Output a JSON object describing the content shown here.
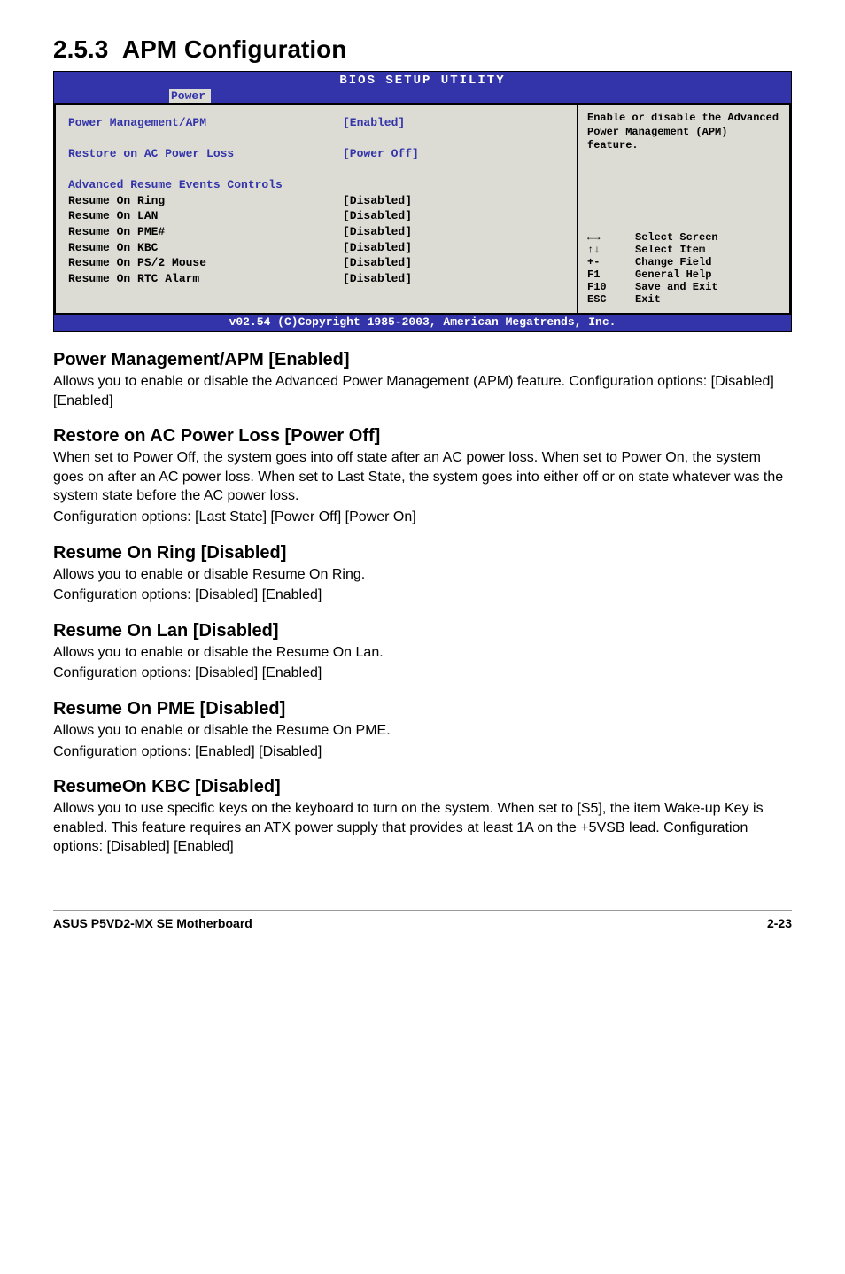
{
  "section": {
    "number": "2.5.3",
    "title": "APM Configuration"
  },
  "bios": {
    "title": "BIOS SETUP UTILITY",
    "tab": "Power",
    "left": {
      "rows": [
        {
          "label": "Power Management/APM",
          "value": "[Enabled]",
          "style": "blue"
        },
        {
          "label": "",
          "value": ""
        },
        {
          "label": "Restore on AC Power Loss",
          "value": "[Power Off]",
          "style": "blue"
        },
        {
          "label": "",
          "value": ""
        },
        {
          "label": "Advanced Resume Events Controls",
          "value": "",
          "style": "blue-label-only"
        },
        {
          "label": "Resume On Ring",
          "value": "[Disabled]",
          "style": "black"
        },
        {
          "label": "Resume On LAN",
          "value": "[Disabled]",
          "style": "black"
        },
        {
          "label": "Resume On PME#",
          "value": "[Disabled]",
          "style": "black"
        },
        {
          "label": "Resume On KBC",
          "value": "[Disabled]",
          "style": "black"
        },
        {
          "label": "Resume On PS/2 Mouse",
          "value": "[Disabled]",
          "style": "black"
        },
        {
          "label": "Resume On RTC Alarm",
          "value": "[Disabled]",
          "style": "black"
        }
      ]
    },
    "right": {
      "help": "Enable or disable the Advanced Power Management (APM) feature.",
      "keys": [
        {
          "k": "←→",
          "d": "Select Screen"
        },
        {
          "k": "↑↓",
          "d": "Select Item"
        },
        {
          "k": "+-",
          "d": "Change Field"
        },
        {
          "k": "F1",
          "d": "General Help"
        },
        {
          "k": "F10",
          "d": "Save and Exit"
        },
        {
          "k": "ESC",
          "d": "Exit"
        }
      ]
    },
    "footer": "v02.54 (C)Copyright 1985-2003, American Megatrends, Inc."
  },
  "sections": [
    {
      "h": "Power Management/APM [Enabled]",
      "p": "Allows you to enable or disable the Advanced Power Management (APM) feature. Configuration options: [Disabled] [Enabled]"
    },
    {
      "h": "Restore on AC Power Loss [Power Off]",
      "p": "When set to Power Off, the system goes into off state after an AC power loss. When set to Power On, the system goes on after an AC power loss. When set to Last State, the system goes into either off or on state whatever was the system state before the AC power loss.\nConfiguration options: [Last State] [Power Off] [Power On]"
    },
    {
      "h": "Resume On Ring [Disabled]",
      "p": "Allows you to enable or disable Resume On Ring.\nConfiguration options: [Disabled] [Enabled]"
    },
    {
      "h": "Resume On Lan [Disabled]",
      "p": "Allows you to enable or disable the Resume On Lan.\nConfiguration options: [Disabled] [Enabled]"
    },
    {
      "h": "Resume On PME [Disabled]",
      "p": "Allows you to enable or disable the Resume On PME.\nConfiguration options: [Enabled] [Disabled]"
    },
    {
      "h": "ResumeOn KBC [Disabled]",
      "p": "Allows you to use specific keys on the keyboard to turn on the system. When set to [S5], the item Wake-up Key is enabled. This feature requires an ATX power supply that provides at least 1A on the +5VSB lead. Configuration options: [Disabled] [Enabled]"
    }
  ],
  "footer": {
    "left": "ASUS P5VD2-MX SE Motherboard",
    "right": "2-23"
  }
}
